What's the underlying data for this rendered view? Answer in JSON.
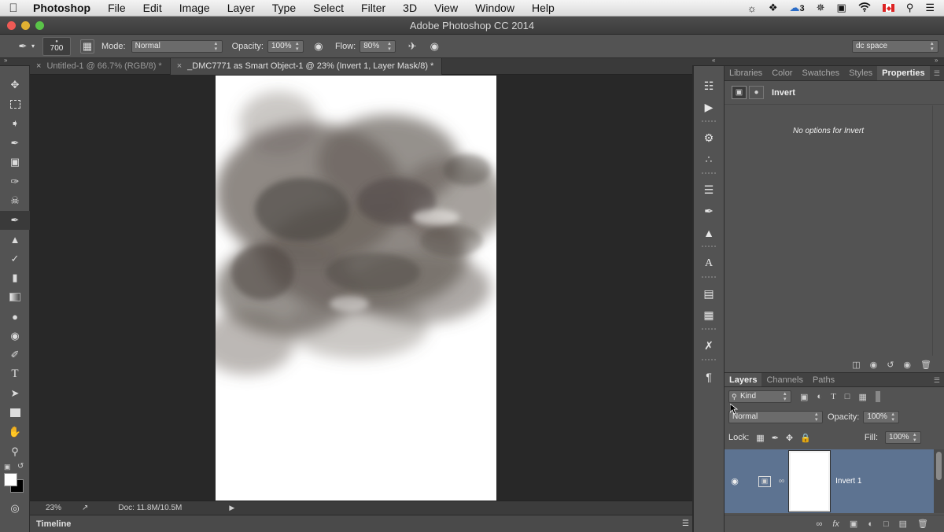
{
  "menubar": {
    "app": "Photoshop",
    "items": [
      "File",
      "Edit",
      "Image",
      "Layer",
      "Type",
      "Select",
      "Filter",
      "3D",
      "View",
      "Window",
      "Help"
    ],
    "status_count": "3"
  },
  "window": {
    "title": "Adobe Photoshop CC 2014"
  },
  "options": {
    "brush_size": "700",
    "mode_label": "Mode:",
    "mode_value": "Normal",
    "opacity_label": "Opacity:",
    "opacity_value": "100%",
    "flow_label": "Flow:",
    "flow_value": "80%",
    "workspace": "dc space"
  },
  "tabs": [
    {
      "label": "Untitled-1 @ 66.7% (RGB/8) *"
    },
    {
      "label": "_DMC7771 as Smart Object-1 @ 23% (Invert 1, Layer Mask/8) *"
    }
  ],
  "status": {
    "zoom": "23%",
    "doc": "Doc: 11.8M/10.5M"
  },
  "timeline": {
    "label": "Timeline"
  },
  "properties_panel": {
    "tabs": [
      "Libraries",
      "Color",
      "Swatches",
      "Styles",
      "Properties"
    ],
    "active_tab": "Properties",
    "adjustment_name": "Invert",
    "message": "No options for Invert"
  },
  "layers_panel": {
    "tabs": [
      "Layers",
      "Channels",
      "Paths"
    ],
    "active_tab": "Layers",
    "filter_kind": "Kind",
    "blend_mode": "Normal",
    "opacity_label": "Opacity:",
    "opacity_value": "100%",
    "lock_label": "Lock:",
    "fill_label": "Fill:",
    "fill_value": "100%",
    "layers": [
      {
        "name": "Invert 1"
      }
    ]
  },
  "colors": {
    "layer_selected": "#5d7391",
    "panel_bg": "#535353",
    "canvas_bg": "#282828"
  }
}
